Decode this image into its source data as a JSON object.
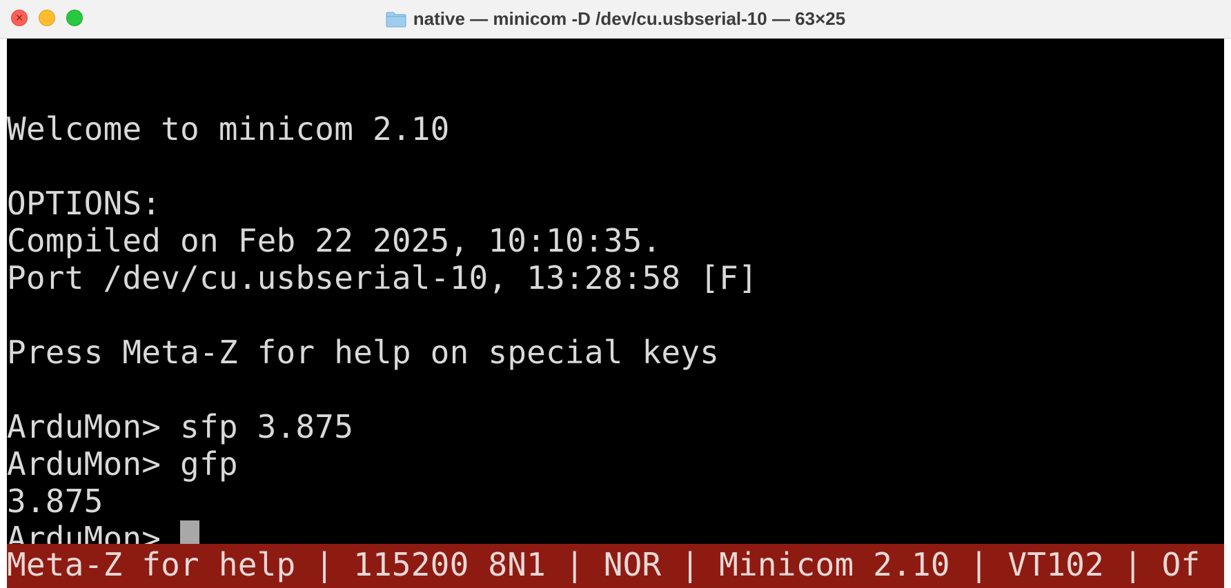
{
  "window": {
    "title": "native — minicom -D /dev/cu.usbserial-10 — 63×25",
    "folder_icon": "folder-icon",
    "controls": [
      "close",
      "minimize",
      "maximize"
    ],
    "close_glyph": "×"
  },
  "terminal": {
    "lines": [
      "",
      "Welcome to minicom 2.10",
      "",
      "OPTIONS:",
      "Compiled on Feb 22 2025, 10:10:35.",
      "Port /dev/cu.usbserial-10, 13:28:58 [F]",
      "",
      "Press Meta-Z for help on special keys",
      "",
      "ArduMon> sfp 3.875",
      "ArduMon> gfp",
      "3.875"
    ],
    "prompt": "ArduMon> ",
    "cursor": "block"
  },
  "statusbar": {
    "text": "Meta-Z for help | 115200 8N1 | NOR | Minicom 2.10 | VT102 | Of"
  },
  "colors": {
    "terminal_bg": "#000000",
    "terminal_fg": "#d9d9d9",
    "statusbar_bg": "#8e1b12",
    "statusbar_fg": "#e6d9d7",
    "close": "#fe5f57",
    "minimize": "#febc2e",
    "maximize": "#28c840"
  }
}
